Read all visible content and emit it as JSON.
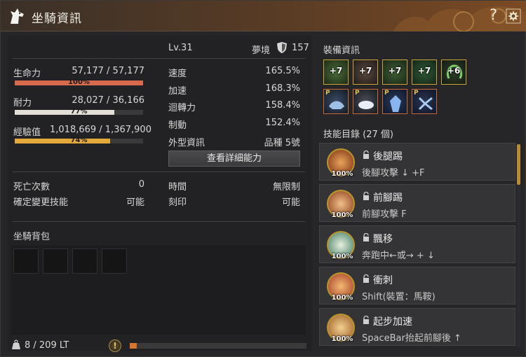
{
  "window": {
    "title": "坐騎資訊",
    "help_label": "?"
  },
  "mount": {
    "name": "",
    "level": "Lv.31",
    "realm_label": "夢境",
    "realm_value": "157"
  },
  "vitals": [
    {
      "label": "生命力",
      "value": "57,177 / 57,177",
      "pct_label": "100%",
      "fraction": 1.0,
      "color": "#d86a4e"
    },
    {
      "label": "耐力",
      "value": "28,027 / 36,166",
      "pct_label": "77%",
      "fraction": 0.775,
      "color": "#e3dfd7"
    },
    {
      "label": "經驗值",
      "value": "1,018,669 / 1,367,900",
      "pct_label": "74%",
      "fraction": 0.745,
      "color": "#e3a93a"
    }
  ],
  "stats": [
    {
      "label": "速度",
      "value": "165.5%"
    },
    {
      "label": "加速",
      "value": "168.3%"
    },
    {
      "label": "迴轉力",
      "value": "158.4%"
    },
    {
      "label": "制動",
      "value": "152.4%"
    },
    {
      "label": "外型資訊",
      "value": "品種 5號"
    }
  ],
  "detail_button": "查看詳細能力",
  "extra_left": [
    {
      "label": "死亡次數",
      "value": "0"
    },
    {
      "label": "確定變更技能",
      "value": "可能"
    }
  ],
  "extra_right": [
    {
      "label": "時間",
      "value": "無限制"
    },
    {
      "label": "刻印",
      "value": "可能"
    }
  ],
  "bag": {
    "title": "坐騎背包",
    "weight": "8 / 209 LT",
    "weight_fraction": 0.04
  },
  "equipment": {
    "title": "裝備資訊",
    "top_row": [
      "+7",
      "+7",
      "+7",
      "+7",
      "+6"
    ],
    "bottom_row_tag": "P"
  },
  "skills": {
    "title": "技能目錄 (27 個)",
    "items": [
      {
        "name": "後腿踢",
        "command": "後腳攻擊 ↓ +F",
        "pct": "100%"
      },
      {
        "name": "前腳踢",
        "command": "前腳攻擊 F",
        "pct": "100%"
      },
      {
        "name": "飄移",
        "command": "奔跑中←或→ + ↓",
        "pct": "100%"
      },
      {
        "name": "衝刺",
        "command": "Shift(裝置：馬鞍)",
        "pct": "100%"
      },
      {
        "name": "起步加速",
        "command": "SpaceBar抬起前腳後 ↑",
        "pct": "100%"
      }
    ]
  }
}
